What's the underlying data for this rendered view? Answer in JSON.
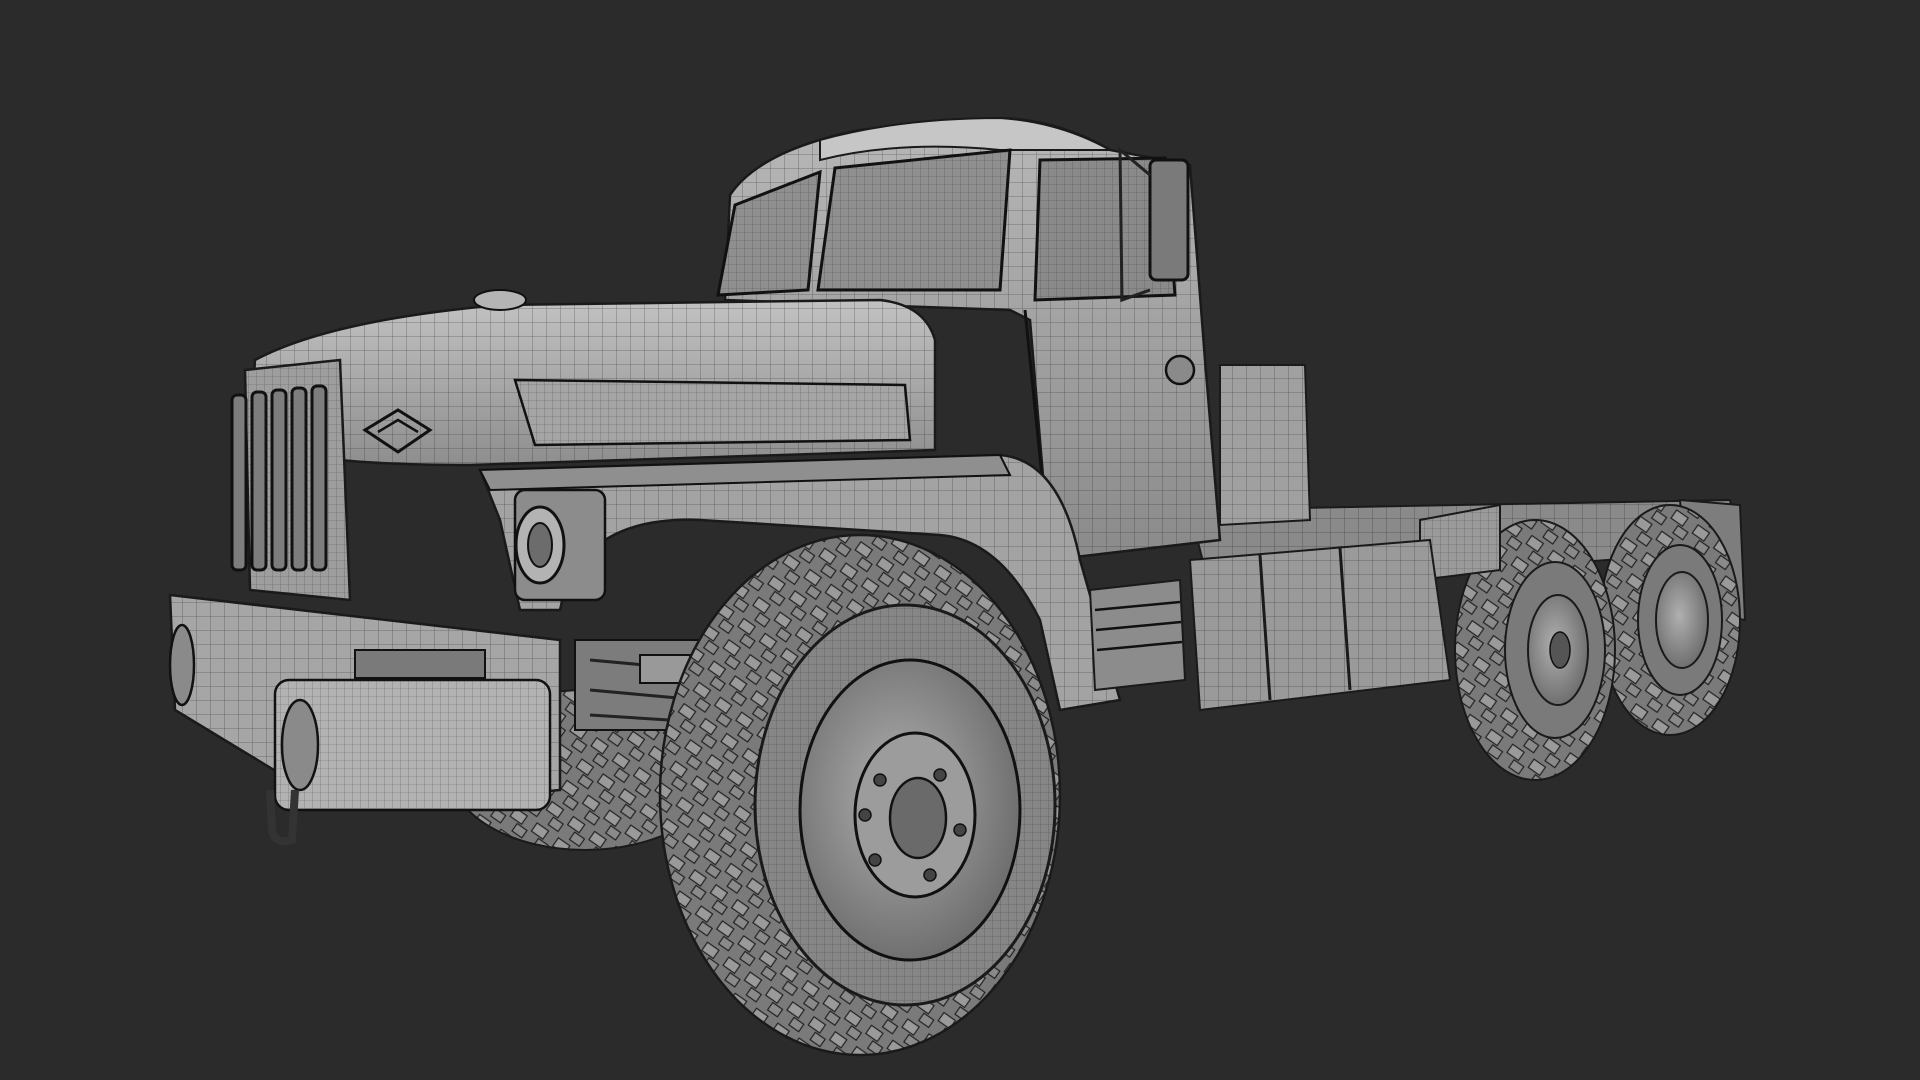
{
  "scene": {
    "subject_icon": "wireframe-truck-render",
    "colors": {
      "background": "#2b2b2b",
      "body_light": "#a9a9a9",
      "body_mid": "#8c8c8c",
      "body_dark": "#5e5e5e",
      "tire": "#6f6f6f",
      "wire": "#1a1a1a"
    }
  }
}
